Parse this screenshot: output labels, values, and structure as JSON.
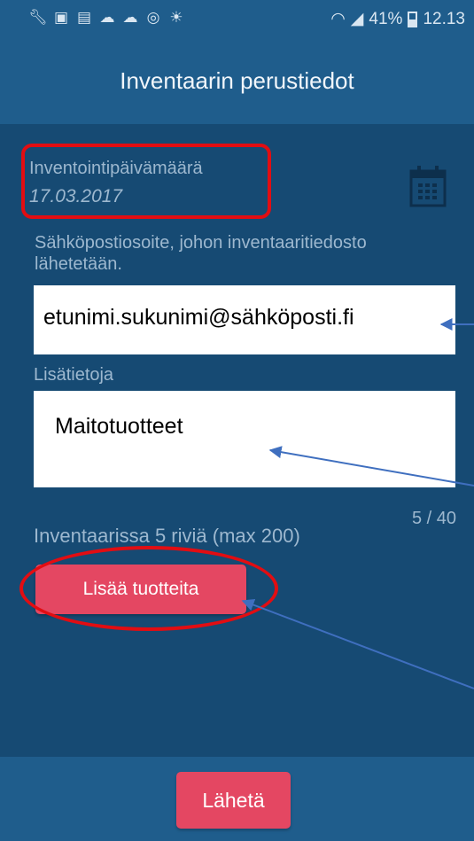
{
  "status_bar": {
    "left_icons": [
      "wrench-icon",
      "image-icon",
      "gallery-icon",
      "cloud-icon",
      "cloud-icon",
      "sync-icon",
      "weather-icon"
    ],
    "battery_percent": "41%",
    "time": "12.13"
  },
  "header": {
    "title": "Inventaarin perustiedot"
  },
  "form": {
    "date_label": "Inventointipäivämäärä",
    "date_value": "17.03.2017",
    "email_label": "Sähköpostiosoite, johon inventaaritiedosto lähetetään.",
    "email_value": "etunimi.sukunimi@sähköposti.fi",
    "notes_label": "Lisätietoja",
    "notes_value": "Maitotuotteet",
    "notes_counter": "5 / 40",
    "rows_info": "Inventaarissa 5 riviä (max 200)",
    "add_products_label": "Lisää tuotteita"
  },
  "footer": {
    "send_label": "Lähetä"
  },
  "colors": {
    "background": "#164a73",
    "bar": "#1f5d8c",
    "accent_button": "#e44762",
    "highlight": "#e20d12",
    "muted_text": "#9db8cf"
  }
}
